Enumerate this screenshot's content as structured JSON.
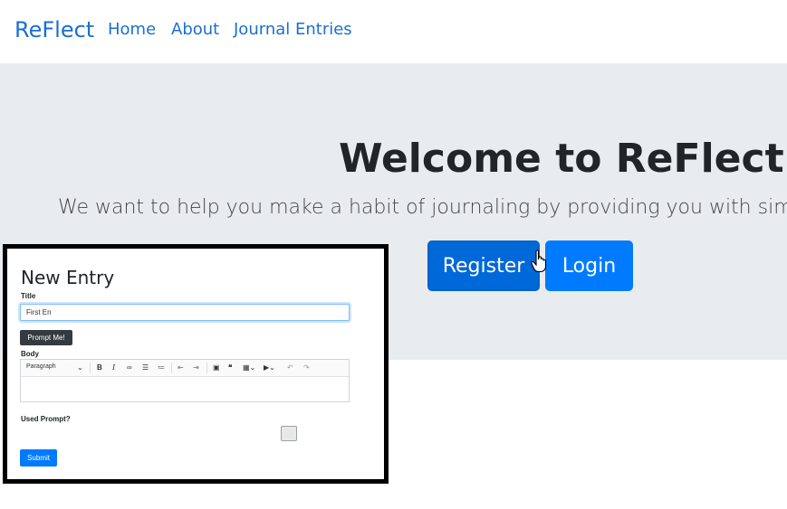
{
  "navbar": {
    "brand": "ReFlect",
    "links": [
      "Home",
      "About",
      "Journal Entries"
    ]
  },
  "hero": {
    "title": "Welcome to ReFlect",
    "lead": "We want to help you make a habit of journaling by providing you with simple, tho",
    "register_label": "Register",
    "login_label": "Login"
  },
  "form": {
    "heading": "New Entry",
    "title_label": "Title",
    "title_value": "First En",
    "prompt_button": "Prompt Me!",
    "body_label": "Body",
    "toolbar_heading": "Paragraph",
    "used_prompt_label": "Used Prompt?",
    "submit_label": "Submit"
  },
  "colors": {
    "brand": "#1a6fd1",
    "primary": "#007bff",
    "hero_bg": "#e9ecef"
  }
}
